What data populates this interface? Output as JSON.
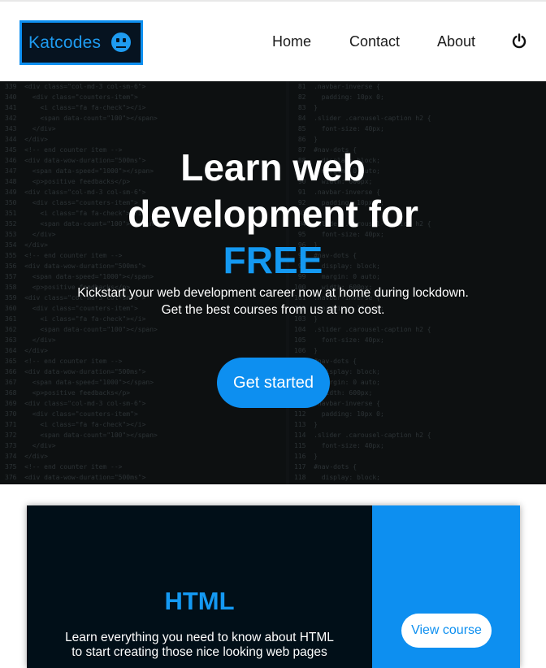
{
  "navbar": {
    "logo_text": "Katcodes",
    "links": {
      "home": "Home",
      "contact": "Contact",
      "about": "About"
    },
    "power_icon": "power-icon"
  },
  "hero": {
    "title_line1": "Learn web",
    "title_line2": "development for",
    "title_highlight": "FREE",
    "subtitle_line1": "Kickstart your web development career now at home during lockdown.",
    "subtitle_line2": "Get the best courses from us at no cost.",
    "cta_label": "Get started"
  },
  "course": {
    "title": "HTML",
    "description_line1": "Learn everything you need to know about HTML",
    "description_line2": "to start creating those nice looking web pages",
    "button_label": "View course"
  },
  "colors": {
    "accent": "#0d8ff0",
    "dark": "#010f18"
  }
}
